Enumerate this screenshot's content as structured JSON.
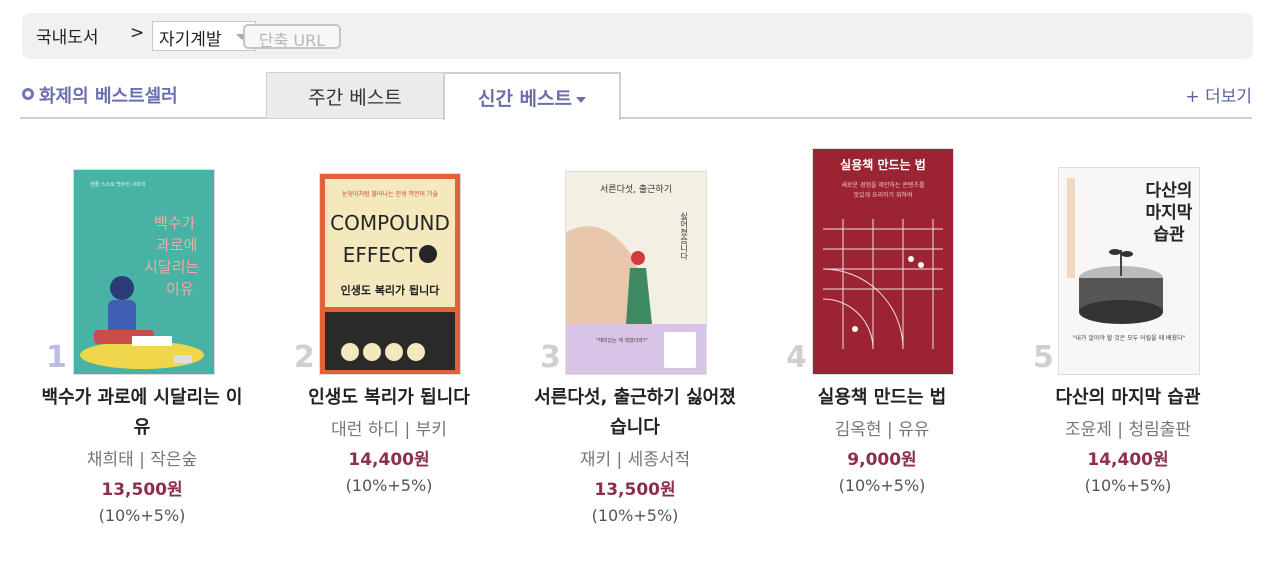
{
  "breadcrumb": {
    "root": "국내도서",
    "separator": ">",
    "category": "자기계발",
    "short_url": "단축 URL"
  },
  "section": {
    "title": "화제의 베스트셀러",
    "tabs": [
      {
        "label": "주간 베스트",
        "active": false
      },
      {
        "label": "신간 베스트",
        "active": true
      }
    ],
    "more": "+ 더보기"
  },
  "colors": {
    "accent": "#6b6fb0",
    "price": "#8e2e4e"
  },
  "books": [
    {
      "rank": "1",
      "title_line1": "백수가 과로에 시달리는 이",
      "title_line2": "유",
      "author": "채희태 | 작은숲",
      "price": "13,500원",
      "discount": "(10%+5%)",
      "cover": {
        "title_lines": [
          "백수가",
          "과로에",
          "시달리는",
          "이유"
        ]
      }
    },
    {
      "rank": "2",
      "title_line1": "인생도 복리가 됩니다",
      "title_line2": "",
      "author": "대런 하디 | 부키",
      "price": "14,400원",
      "discount": "(10%+5%)",
      "cover": {
        "kicker": "눈덩이처럼 불어나는 인생 역전의 기술",
        "big1": "COMPOUND",
        "big2": "EFFECT",
        "sub": "인생도 복리가 됩니다"
      }
    },
    {
      "rank": "3",
      "title_line1": "서른다섯, 출근하기 싫어졌",
      "title_line2": "습니다",
      "author": "재키 | 세종서적",
      "price": "13,500원",
      "discount": "(10%+5%)",
      "cover": {
        "title": "서른다섯, 출근하기",
        "vertical": "싫어졌습니다"
      }
    },
    {
      "rank": "4",
      "title_line1": "실용책 만드는 법",
      "title_line2": "",
      "author": "김옥현 | 유유",
      "price": "9,000원",
      "discount": "(10%+5%)",
      "cover": {
        "title": "실용책 만드는 법",
        "sub1": "새로운 경험을 제안하는 콘텐츠를",
        "sub2": "맛있게 요리하기 위하여"
      }
    },
    {
      "rank": "5",
      "title_line1": "다산의 마지막 습관",
      "title_line2": "",
      "author": "조윤제 | 청림출판",
      "price": "14,400원",
      "discount": "(10%+5%)",
      "cover": {
        "title_lines": [
          "다산의",
          "마지막",
          "습관"
        ]
      }
    }
  ]
}
